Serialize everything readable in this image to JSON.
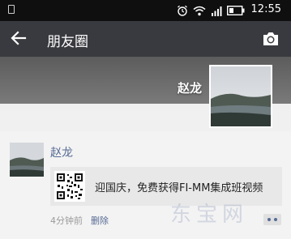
{
  "status_bar": {
    "time": "12:55"
  },
  "nav": {
    "title": "朋友圈"
  },
  "profile": {
    "name": "赵龙"
  },
  "post": {
    "author": "赵龙",
    "link_title": "迎国庆，免费获得FI-MM集成班视频",
    "time_ago": "4分钟前",
    "delete_label": "删除"
  },
  "watermark": {
    "text": "东宝网"
  },
  "colors": {
    "nav_bg": "#393a3f",
    "status_bg": "#0f0f0f",
    "link_blue": "#576b95"
  }
}
